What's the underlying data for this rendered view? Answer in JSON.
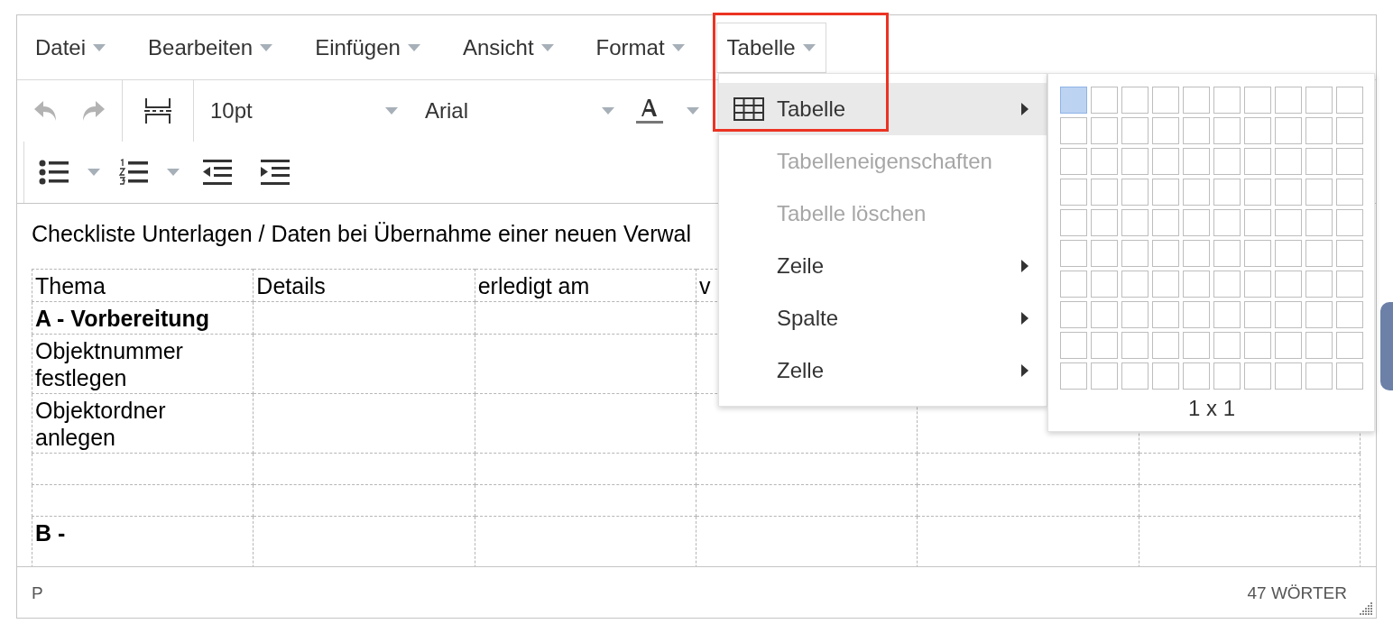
{
  "menubar": [
    {
      "label": "Datei",
      "selected": false
    },
    {
      "label": "Bearbeiten",
      "selected": false
    },
    {
      "label": "Einfügen",
      "selected": false
    },
    {
      "label": "Ansicht",
      "selected": false
    },
    {
      "label": "Format",
      "selected": false
    },
    {
      "label": "Tabelle",
      "selected": true
    }
  ],
  "toolbar": {
    "undo_disabled": true,
    "redo_disabled": true,
    "font_size": "10pt",
    "font_family": "Arial"
  },
  "document": {
    "heading": "Checkliste Unterlagen / Daten bei Übernahme einer neuen Verwal",
    "table": {
      "rows": [
        {
          "kind": "header",
          "cells": [
            "Thema",
            "Details",
            "erledigt am",
            "v"
          ]
        },
        {
          "kind": "section",
          "cells": [
            "A - Vorbereitung"
          ]
        },
        {
          "kind": "plain",
          "cells": [
            "Objektnummer festlegen"
          ]
        },
        {
          "kind": "plain",
          "cells": [
            "Objektordner anlegen"
          ]
        },
        {
          "kind": "plain",
          "cells": []
        },
        {
          "kind": "plain",
          "cells": []
        },
        {
          "kind": "section",
          "cells": [
            "B -"
          ]
        }
      ]
    }
  },
  "menu": {
    "items": [
      {
        "kind": "table",
        "label": "Tabelle",
        "selected": true,
        "disabled": false,
        "submenu": true
      },
      {
        "kind": "plain",
        "label": "Tabelleneigenschaften",
        "selected": false,
        "disabled": true,
        "submenu": false
      },
      {
        "kind": "plain",
        "label": "Tabelle löschen",
        "selected": false,
        "disabled": true,
        "submenu": false
      },
      {
        "kind": "plain",
        "label": "Zeile",
        "selected": false,
        "disabled": false,
        "submenu": true
      },
      {
        "kind": "plain",
        "label": "Spalte",
        "selected": false,
        "disabled": false,
        "submenu": true
      },
      {
        "kind": "plain",
        "label": "Zelle",
        "selected": false,
        "disabled": false,
        "submenu": true
      }
    ]
  },
  "table_picker": {
    "label": "1 x 1",
    "rows": [
      [
        true,
        false,
        false,
        false,
        false,
        false,
        false,
        false,
        false,
        false
      ],
      [
        false,
        false,
        false,
        false,
        false,
        false,
        false,
        false,
        false,
        false
      ],
      [
        false,
        false,
        false,
        false,
        false,
        false,
        false,
        false,
        false,
        false
      ],
      [
        false,
        false,
        false,
        false,
        false,
        false,
        false,
        false,
        false,
        false
      ],
      [
        false,
        false,
        false,
        false,
        false,
        false,
        false,
        false,
        false,
        false
      ],
      [
        false,
        false,
        false,
        false,
        false,
        false,
        false,
        false,
        false,
        false
      ],
      [
        false,
        false,
        false,
        false,
        false,
        false,
        false,
        false,
        false,
        false
      ],
      [
        false,
        false,
        false,
        false,
        false,
        false,
        false,
        false,
        false,
        false
      ],
      [
        false,
        false,
        false,
        false,
        false,
        false,
        false,
        false,
        false,
        false
      ],
      [
        false,
        false,
        false,
        false,
        false,
        false,
        false,
        false,
        false,
        false
      ]
    ]
  },
  "status_bar": {
    "path": "P",
    "word_count": "47 WÖRTER"
  }
}
